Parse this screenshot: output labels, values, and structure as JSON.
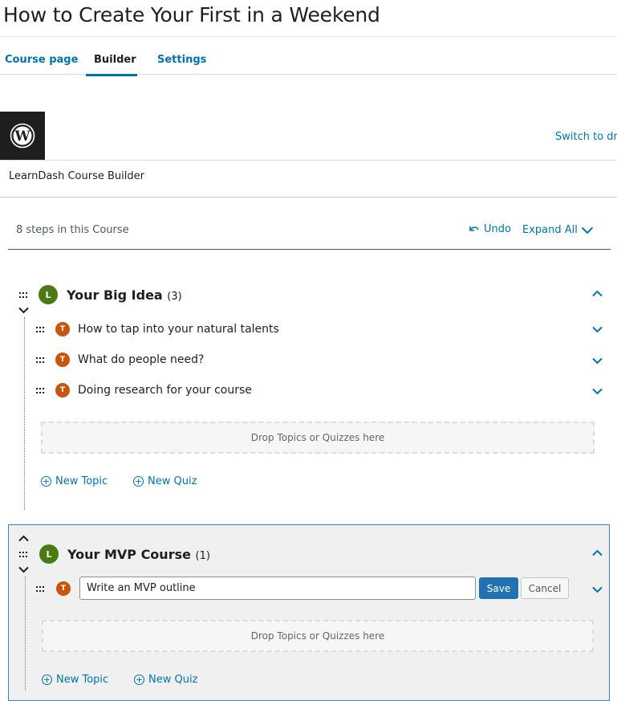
{
  "page": {
    "title": "How to Create Your First in a Weekend"
  },
  "tabs": [
    {
      "label": "Course page",
      "active": false
    },
    {
      "label": "Builder",
      "active": true
    },
    {
      "label": "Settings",
      "active": false
    }
  ],
  "header": {
    "switch_label": "Switch to dra",
    "builder_title": "LearnDash Course Builder"
  },
  "toolbar": {
    "steps_count": "8 steps in this Course",
    "undo_label": "Undo",
    "expand_label": "Expand All"
  },
  "lessons": [
    {
      "badge": "L",
      "title": "Your Big Idea",
      "count": "(3)",
      "topics": [
        {
          "badge": "T",
          "title": "How to tap into your natural talents"
        },
        {
          "badge": "T",
          "title": "What do people need?"
        },
        {
          "badge": "T",
          "title": "Doing research for your course"
        }
      ],
      "drop_label": "Drop Topics or Quizzes here",
      "new_topic_label": "New Topic",
      "new_quiz_label": "New Quiz"
    },
    {
      "badge": "L",
      "title": "Your MVP Course",
      "count": "(1)",
      "editing_topic": {
        "badge": "T",
        "value": "Write an MVP outline",
        "save_label": "Save",
        "cancel_label": "Cancel"
      },
      "drop_label": "Drop Topics or Quizzes here",
      "new_topic_label": "New Topic",
      "new_quiz_label": "New Quiz"
    }
  ],
  "colors": {
    "link": "#0073aa",
    "lesson_badge": "#4a7b13",
    "topic_badge": "#c9540e",
    "primary_button": "#2271b1"
  }
}
